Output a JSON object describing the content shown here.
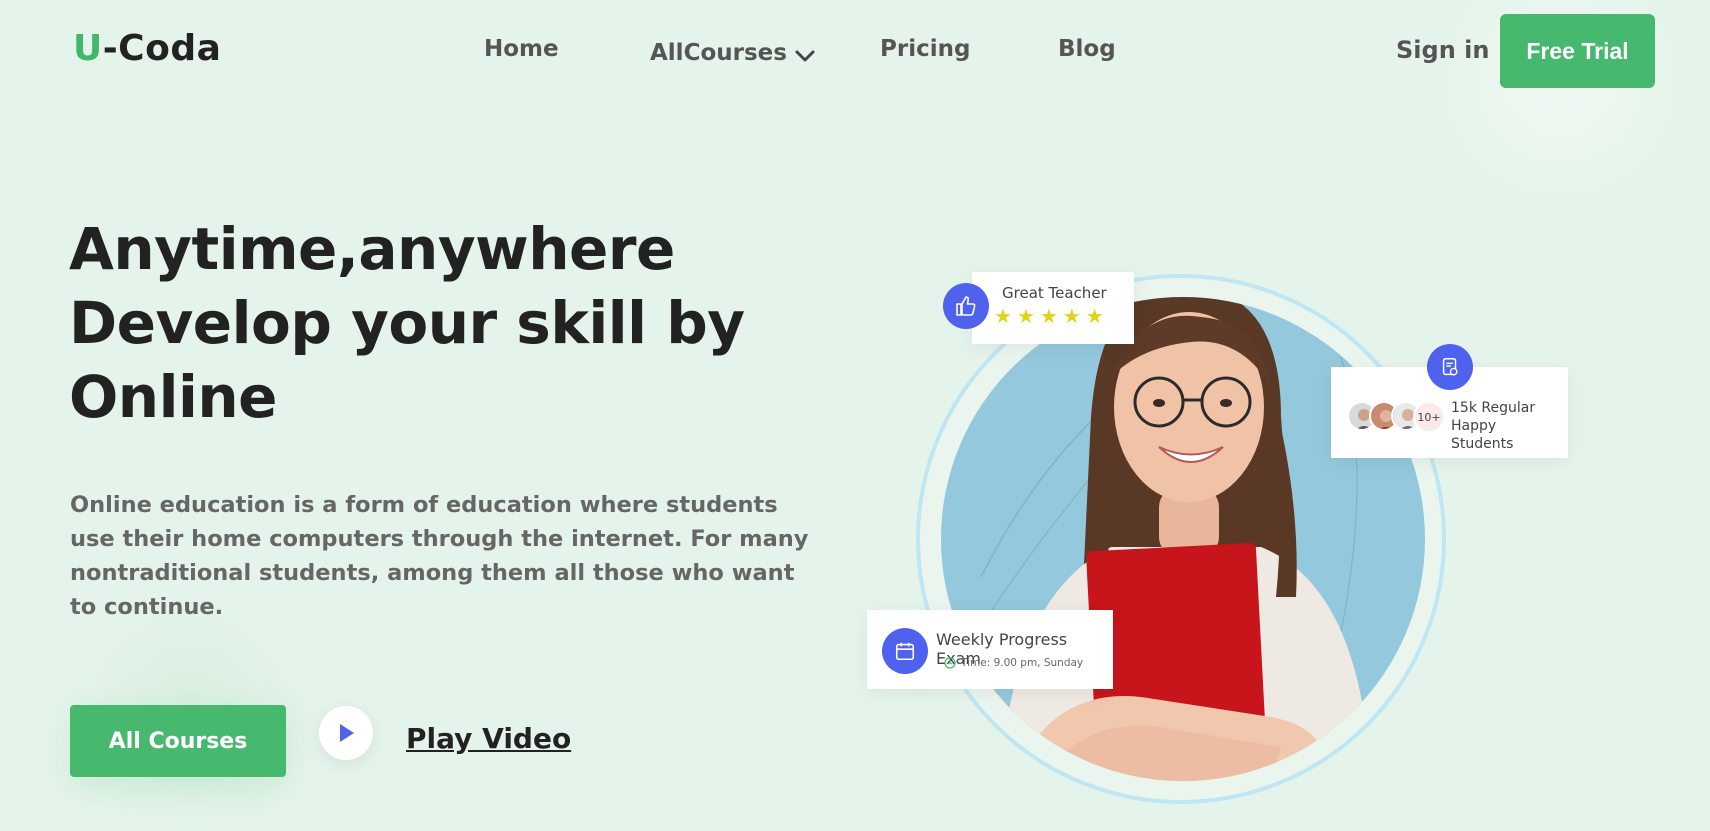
{
  "brand": {
    "logo_u": "U",
    "logo_rest": "-Coda",
    "accent": "#41b96b"
  },
  "nav": {
    "home": "Home",
    "courses": "AllCourses",
    "pricing": "Pricing",
    "blog": "Blog",
    "signin": "Sign in",
    "trial": "Free Trial"
  },
  "hero": {
    "title_lines": [
      "Anytime,anywhere",
      "Develop your skill by",
      "Online"
    ],
    "description": "Online education is a form of education where students use their home computers through the internet. For many nontraditional students, among them all those who want to continue.",
    "cta_primary": "All Courses",
    "cta_video": "Play Video"
  },
  "cards": {
    "teacher": {
      "label": "Great Teacher",
      "stars": 5,
      "icon": "thumbs-up-icon"
    },
    "students": {
      "count_badge": "10+",
      "line1": "15k Regular",
      "line2": "Happy Students",
      "icon": "certificate-icon"
    },
    "exam": {
      "title": "Weekly Progress Exam",
      "time": "Time: 9.00 pm, Sunday",
      "icon": "calendar-icon"
    }
  },
  "colors": {
    "background": "#e5f4ea",
    "primary_button": "#46b96f",
    "badge_blue": "#4f62ee",
    "star": "#e3d317"
  }
}
